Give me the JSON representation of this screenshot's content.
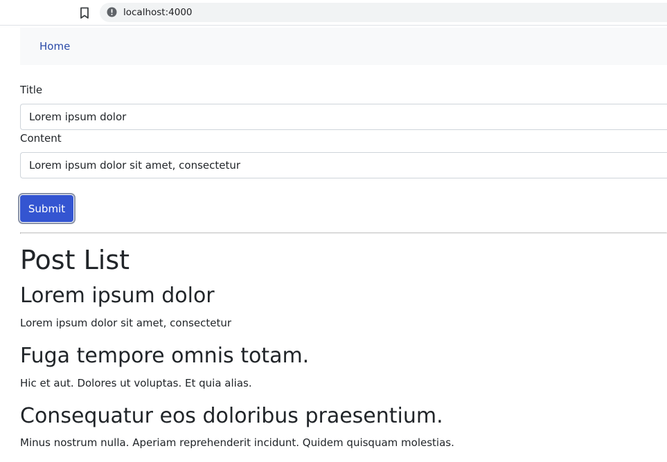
{
  "browser": {
    "url": "localhost:4000",
    "icons": [
      "bookmark-icon",
      "info-icon"
    ]
  },
  "navbar": {
    "home_label": "Home"
  },
  "form": {
    "title_label": "Title",
    "title_value": "Lorem ipsum dolor",
    "content_label": "Content",
    "content_value": "Lorem ipsum dolor sit amet, consectetur",
    "submit_label": "Submit",
    "accent_color": "#3455d1"
  },
  "post_list": {
    "heading": "Post List",
    "posts": [
      {
        "title": "Lorem ipsum dolor",
        "content": "Lorem ipsum dolor sit amet, consectetur"
      },
      {
        "title": "Fuga tempore omnis totam.",
        "content": "Hic et aut. Dolores ut voluptas. Et quia alias."
      },
      {
        "title": "Consequatur eos doloribus praesentium.",
        "content": "Minus nostrum nulla. Aperiam reprehenderit incidunt. Quidem quisquam molestias."
      }
    ]
  }
}
